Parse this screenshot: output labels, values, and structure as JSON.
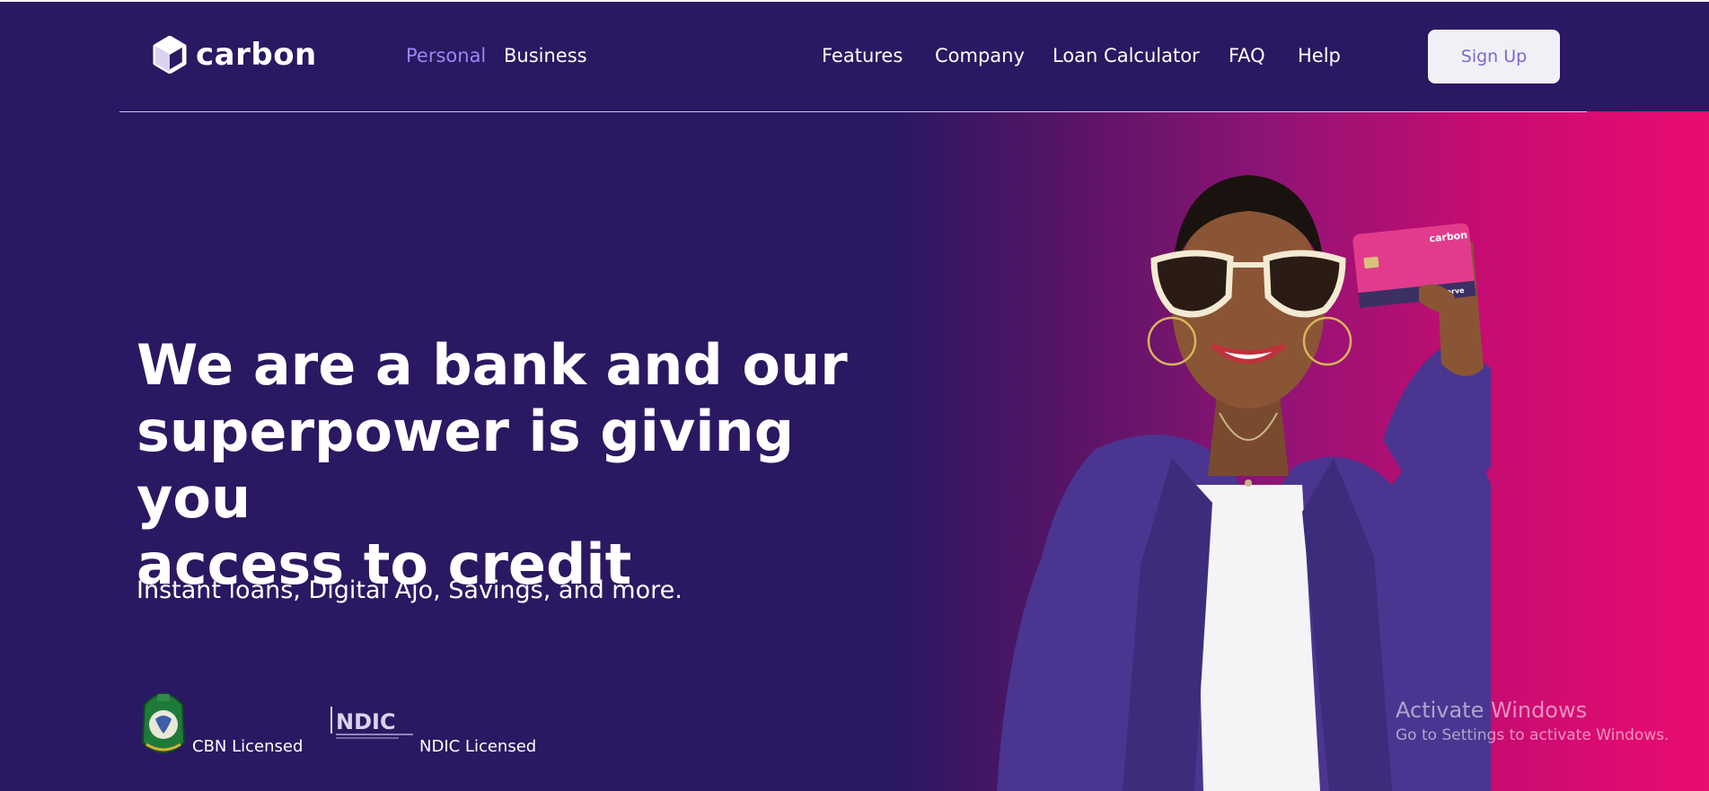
{
  "brand": {
    "name": "carbon",
    "primary_bg": "#2b1862",
    "accent": "#9a86f3",
    "gradient_end": "#ea0c70"
  },
  "nav": {
    "segment_links": [
      {
        "label": "Personal",
        "active": true
      },
      {
        "label": "Business",
        "active": false
      }
    ],
    "main_links": [
      {
        "label": "Features"
      },
      {
        "label": "Company"
      },
      {
        "label": "Loan Calculator"
      },
      {
        "label": "FAQ"
      },
      {
        "label": "Help"
      }
    ],
    "signup_label": "Sign Up"
  },
  "hero": {
    "headline_lines": [
      "We are a bank and our",
      "superpower is giving you",
      "access to credit"
    ],
    "subheadline": "Instant loans, Digital Ajo, Savings, and more.",
    "card_brand": "carbon",
    "card_network": "Verve"
  },
  "licenses": {
    "cbn_label": "CBN Licensed",
    "ndic_logo_text": "NDIC",
    "ndic_label": "NDIC Licensed"
  },
  "watermark": {
    "title": "Activate Windows",
    "subtitle": "Go to Settings to activate Windows."
  },
  "icons": {
    "logo": "carbon-hexagon-logo-icon",
    "cbn": "cbn-seal-icon",
    "ndic": "ndic-logo-icon"
  }
}
